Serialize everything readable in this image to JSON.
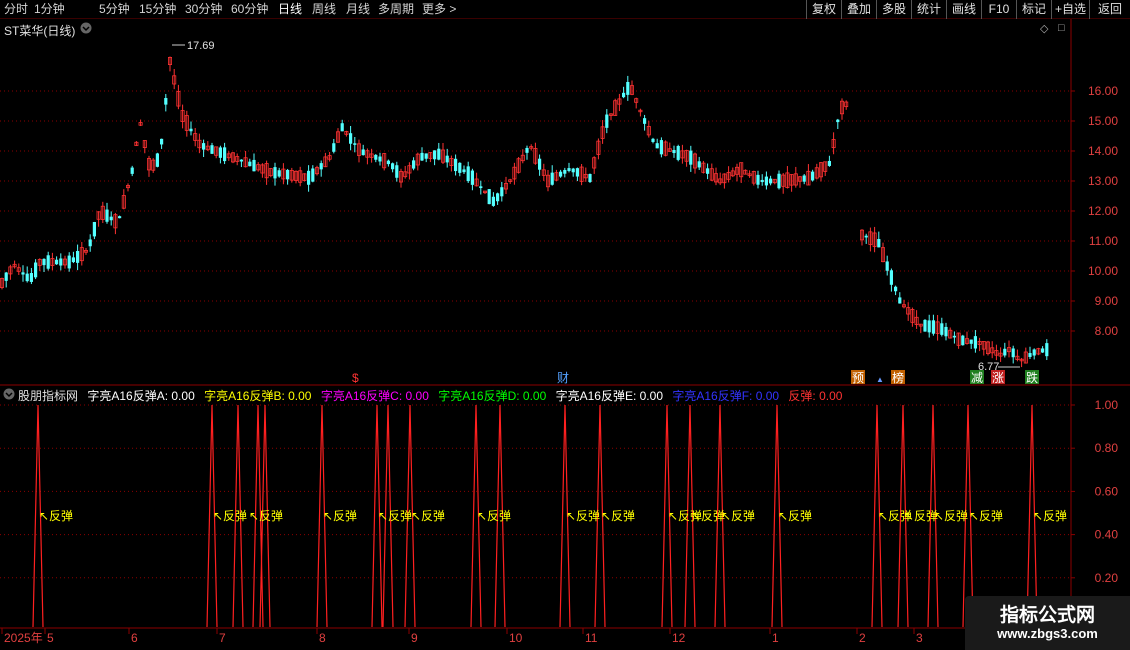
{
  "toolbar": {
    "periods": [
      "分时",
      "1分钟",
      "5分钟",
      "15分钟",
      "30分钟",
      "60分钟",
      "日线",
      "周线",
      "月线",
      "多周期",
      "更多 >"
    ],
    "active_period": "日线",
    "right_buttons": [
      "复权",
      "叠加",
      "多股",
      "统计",
      "画线",
      "F10",
      "标记",
      "+自选",
      "返回"
    ]
  },
  "main_panel": {
    "stock_title": "ST菜华(日线)",
    "high_label": "17.69",
    "low_label": "6.77",
    "y_ticks": [
      "16.00",
      "15.00",
      "14.00",
      "13.00",
      "12.00",
      "11.00",
      "10.00",
      "9.00",
      "8.00"
    ],
    "markers": [
      "$",
      "财",
      "预",
      "榜",
      "减",
      "涨",
      "跌"
    ]
  },
  "indicator_panel": {
    "name": "股朋指标网",
    "items": [
      {
        "text": "字亮A16反弹A: 0.00",
        "color": "#ffffff"
      },
      {
        "text": "字亮A16反弹B: 0.00",
        "color": "#ffff00"
      },
      {
        "text": "字亮A16反弹C: 0.00",
        "color": "#ff00ff"
      },
      {
        "text": "字亮A16反弹D: 0.00",
        "color": "#00ff00"
      },
      {
        "text": "字亮A16反弹E: 0.00",
        "color": "#ffffff"
      },
      {
        "text": "字亮A16反弹F: 0.00",
        "color": "#3333ff"
      },
      {
        "text": "反弹: 0.00",
        "color": "#ff3333"
      }
    ],
    "signal_label": "反弹",
    "y_ticks": [
      "1.00",
      "0.80",
      "0.60",
      "0.40",
      "0.20"
    ]
  },
  "x_axis": {
    "labels": [
      "2025年",
      "5",
      "6",
      "7",
      "8",
      "9",
      "10",
      "11",
      "12",
      "1",
      "2",
      "3"
    ]
  },
  "watermark": {
    "title": "指标公式网",
    "url": "www.zbgs3.com"
  },
  "colors": {
    "up": "#ff3232",
    "down": "#54ffff",
    "grid": "#8b0000",
    "signal": "#ffff00"
  }
}
